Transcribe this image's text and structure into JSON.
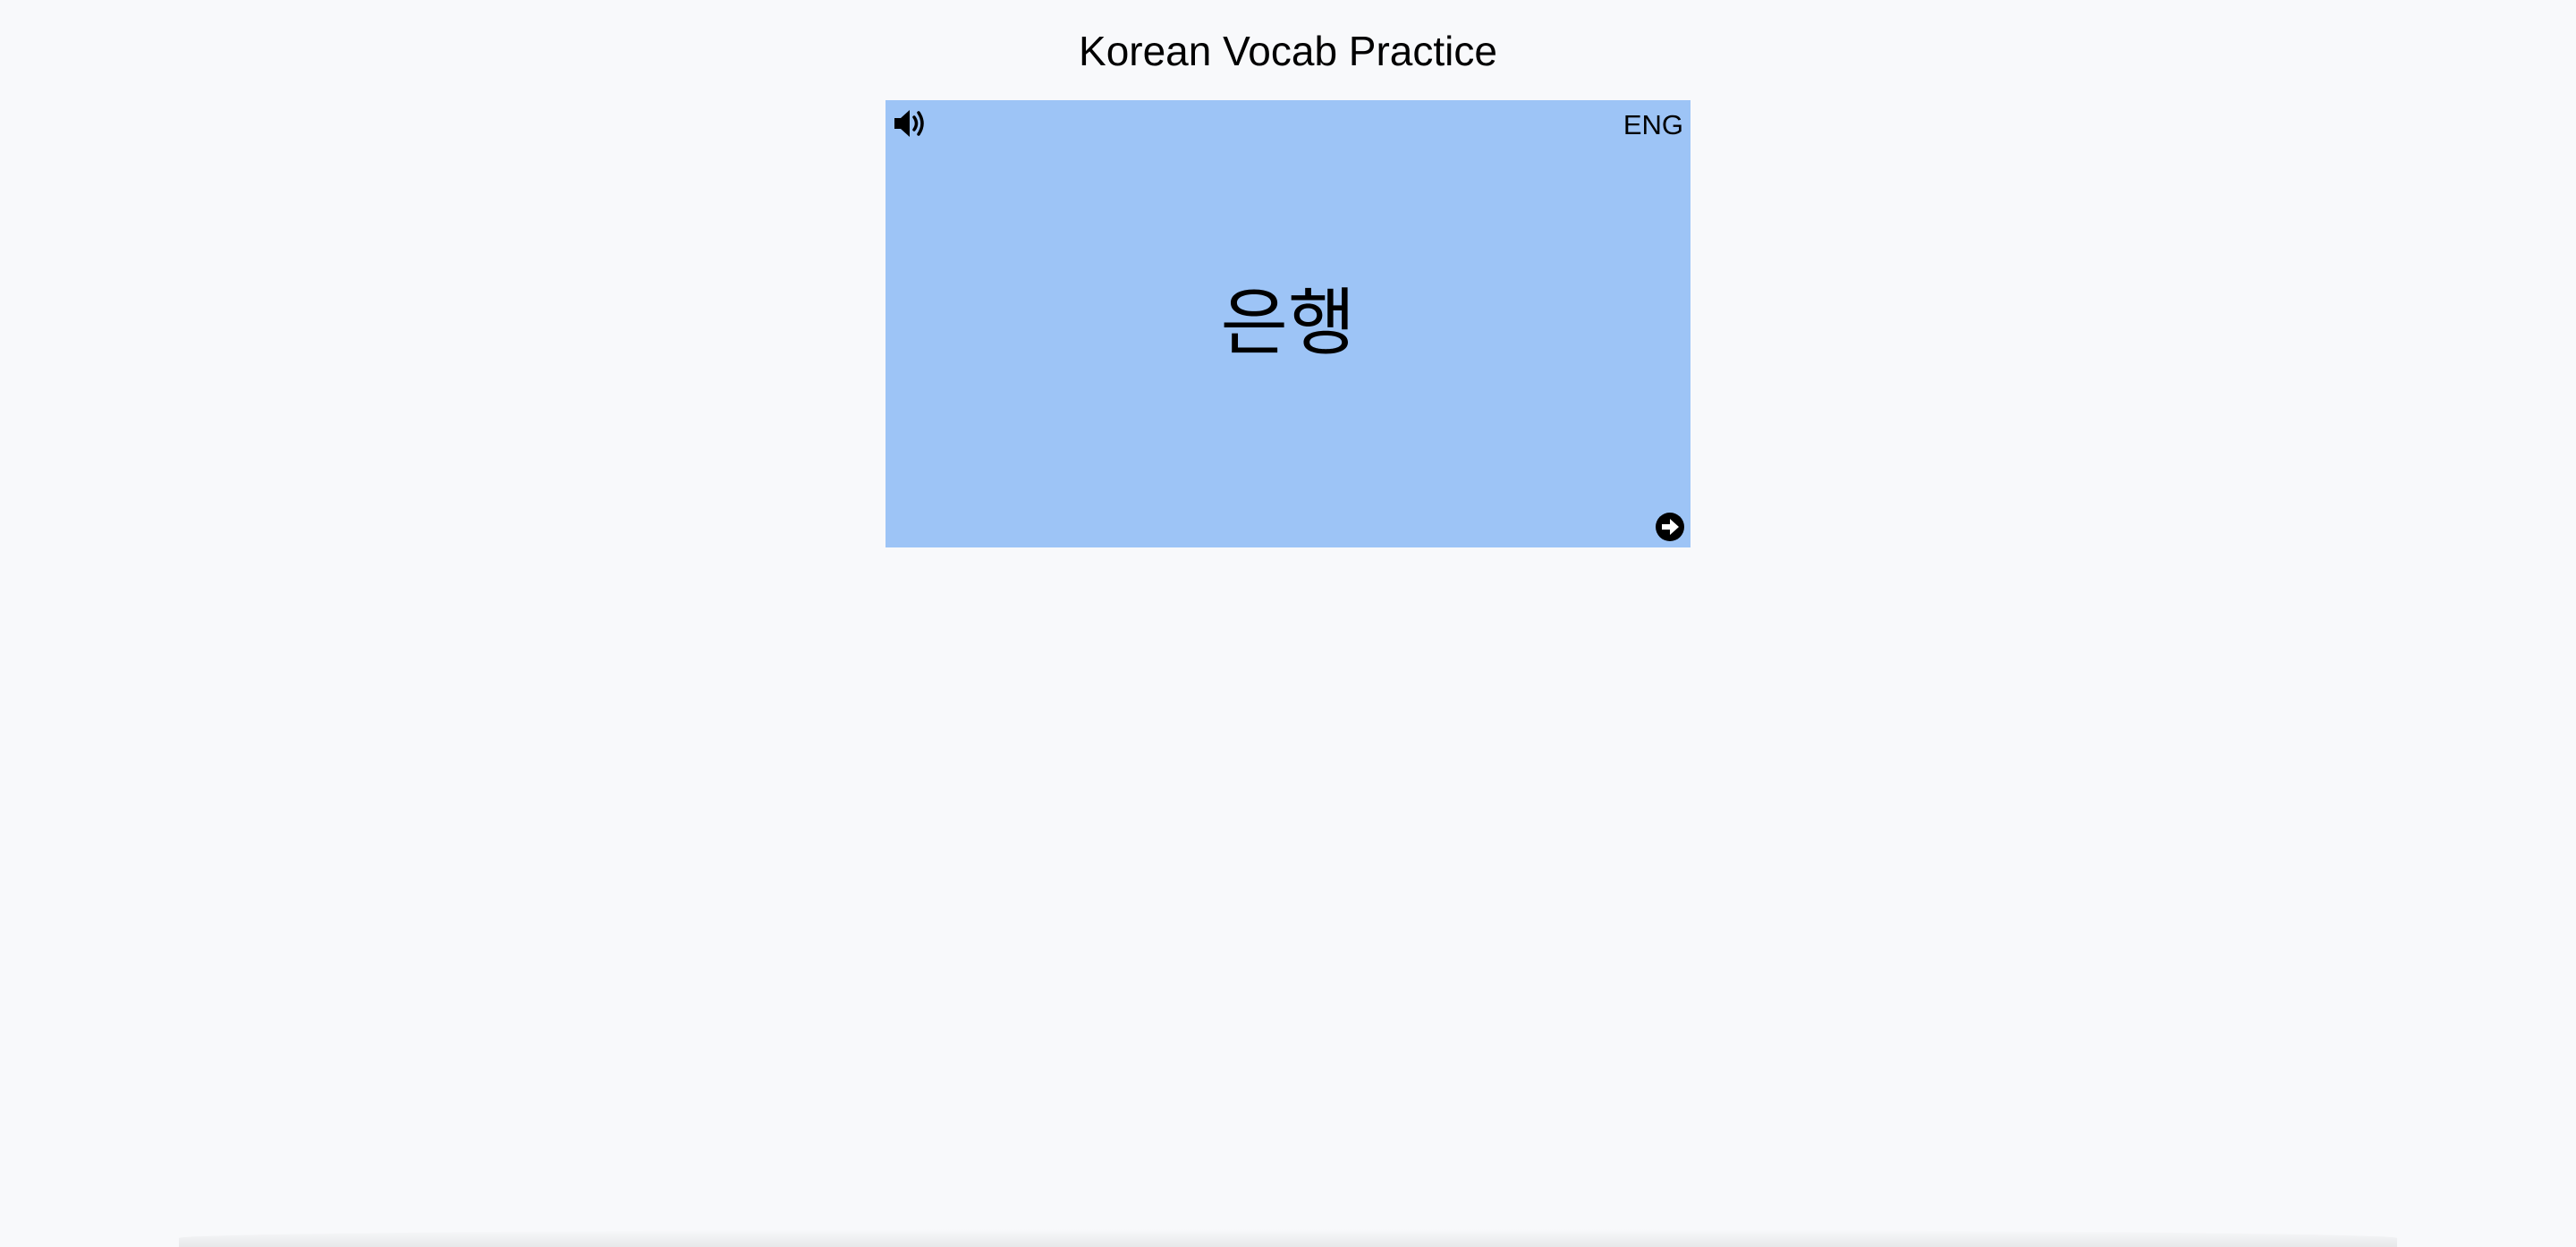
{
  "header": {
    "title": "Korean Vocab Practice"
  },
  "card": {
    "word": "은행",
    "language_toggle": "ENG",
    "background_color": "#9dc4f6",
    "speaker_icon": "volume-up-icon",
    "next_icon": "arrow-circle-right-icon"
  }
}
